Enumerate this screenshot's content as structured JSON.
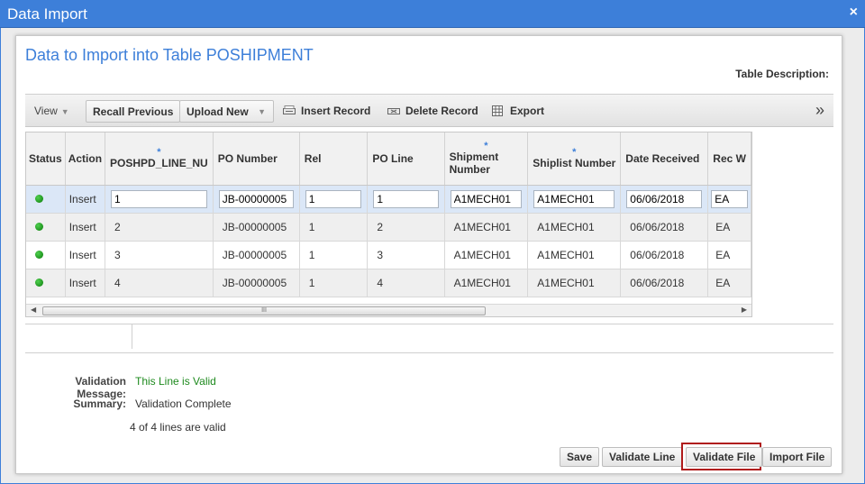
{
  "window": {
    "title": "Data Import",
    "close_label": "×"
  },
  "panel": {
    "heading": "Data to Import into Table POSHIPMENT",
    "table_description_label": "Table Description:"
  },
  "toolbar": {
    "view_label": "View",
    "recall_label": "Recall Previous",
    "upload_label": "Upload New",
    "insert_label": "Insert Record",
    "delete_label": "Delete Record",
    "export_label": "Export",
    "more_label": "»"
  },
  "grid": {
    "columns": {
      "status": "Status",
      "action": "Action",
      "line": "POSHPD_LINE_NU",
      "po_number": "PO Number",
      "rel": "Rel",
      "po_line": "PO Line",
      "shipment": "Shipment Number",
      "shiplist": "Shiplist Number",
      "date": "Date Received",
      "rec": "Rec W"
    },
    "required_marker": "*",
    "rows": [
      {
        "action": "Insert",
        "line": "1",
        "po_number": "JB-00000005",
        "rel": "1",
        "po_line": "1",
        "shipment": "A1MECH01",
        "shiplist": "A1MECH01",
        "date": "06/06/2018",
        "rec": "EA"
      },
      {
        "action": "Insert",
        "line": "2",
        "po_number": "JB-00000005",
        "rel": "1",
        "po_line": "2",
        "shipment": "A1MECH01",
        "shiplist": "A1MECH01",
        "date": "06/06/2018",
        "rec": "EA"
      },
      {
        "action": "Insert",
        "line": "3",
        "po_number": "JB-00000005",
        "rel": "1",
        "po_line": "3",
        "shipment": "A1MECH01",
        "shiplist": "A1MECH01",
        "date": "06/06/2018",
        "rec": "EA"
      },
      {
        "action": "Insert",
        "line": "4",
        "po_number": "JB-00000005",
        "rel": "1",
        "po_line": "4",
        "shipment": "A1MECH01",
        "shiplist": "A1MECH01",
        "date": "06/06/2018",
        "rec": "EA"
      }
    ],
    "scroll_grip": "III"
  },
  "validation": {
    "message_label": "Validation Message:",
    "message_value": "This Line is Valid",
    "summary_label": "Summary:",
    "summary_value": "Validation Complete",
    "lines_valid": "4 of 4 lines are valid"
  },
  "buttons": {
    "save": "Save",
    "validate_line": "Validate Line",
    "validate_file": "Validate File",
    "import_file": "Import File"
  },
  "colors": {
    "titlebar": "#3d7fd9",
    "heading": "#3d7fd9",
    "valid_text": "#1e8a1e",
    "status_ok": "#1aa31a",
    "highlight_border": "#b01c1c",
    "selected_row": "#dbe7f7"
  },
  "icons": {
    "insert": "insert-record-icon",
    "delete": "delete-record-icon",
    "export": "export-icon",
    "status": "status-valid-icon"
  }
}
